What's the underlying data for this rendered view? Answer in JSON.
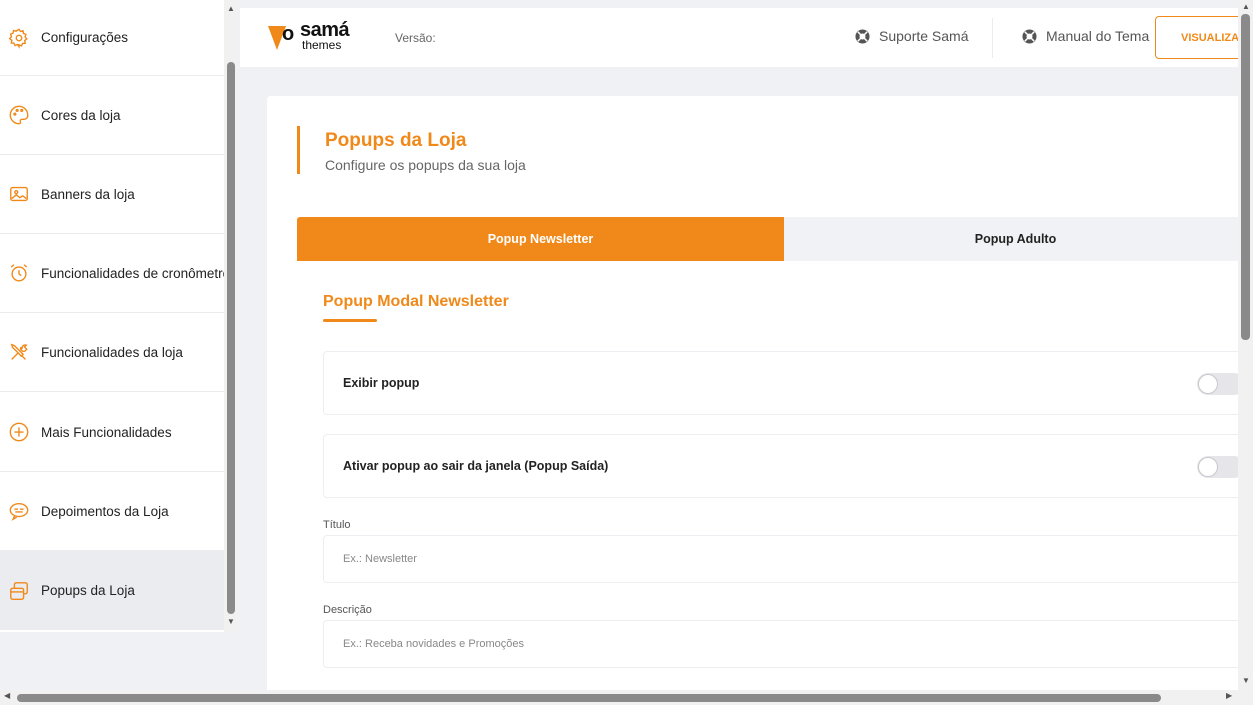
{
  "sidebar": {
    "items": [
      {
        "label": "Configurações",
        "icon": "gear-icon"
      },
      {
        "label": "Cores da loja",
        "icon": "palette-icon"
      },
      {
        "label": "Banners da loja",
        "icon": "image-icon"
      },
      {
        "label": "Funcionalidades de cronômetro",
        "icon": "alarm-clock-icon"
      },
      {
        "label": "Funcionalidades da loja",
        "icon": "tools-icon"
      },
      {
        "label": "Mais Funcionalidades",
        "icon": "plus-circle-icon"
      },
      {
        "label": "Depoimentos da Loja",
        "icon": "chat-bubble-icon"
      },
      {
        "label": "Popups da Loja",
        "icon": "popup-windows-icon"
      }
    ],
    "active_index": 7
  },
  "header": {
    "logo_o": "o",
    "logo_sama": "samá",
    "logo_themes": "themes",
    "version_label": "Versão:",
    "support_label": "Suporte Samá",
    "manual_label": "Manual do Tema",
    "visualize_label": "VISUALIZAR"
  },
  "page": {
    "title": "Popups da Loja",
    "subtitle": "Configure os popups da sua loja"
  },
  "tabs": [
    {
      "label": "Popup Newsletter",
      "active": true
    },
    {
      "label": "Popup Adulto",
      "active": false
    }
  ],
  "section": {
    "title": "Popup Modal Newsletter",
    "show_popup_label": "Exibir popup",
    "show_popup_enabled": false,
    "exit_popup_label": "Ativar popup ao sair da janela (Popup Saída)",
    "exit_popup_enabled": false,
    "title_field": {
      "label": "Título",
      "value": "",
      "placeholder": "Ex.: Newsletter"
    },
    "description_field": {
      "label": "Descrição",
      "value": "",
      "placeholder": "Ex.: Receba novidades e Promoções"
    }
  },
  "colors": {
    "accent": "#f0891a",
    "active_sidebar_bg": "#ebecf0"
  }
}
